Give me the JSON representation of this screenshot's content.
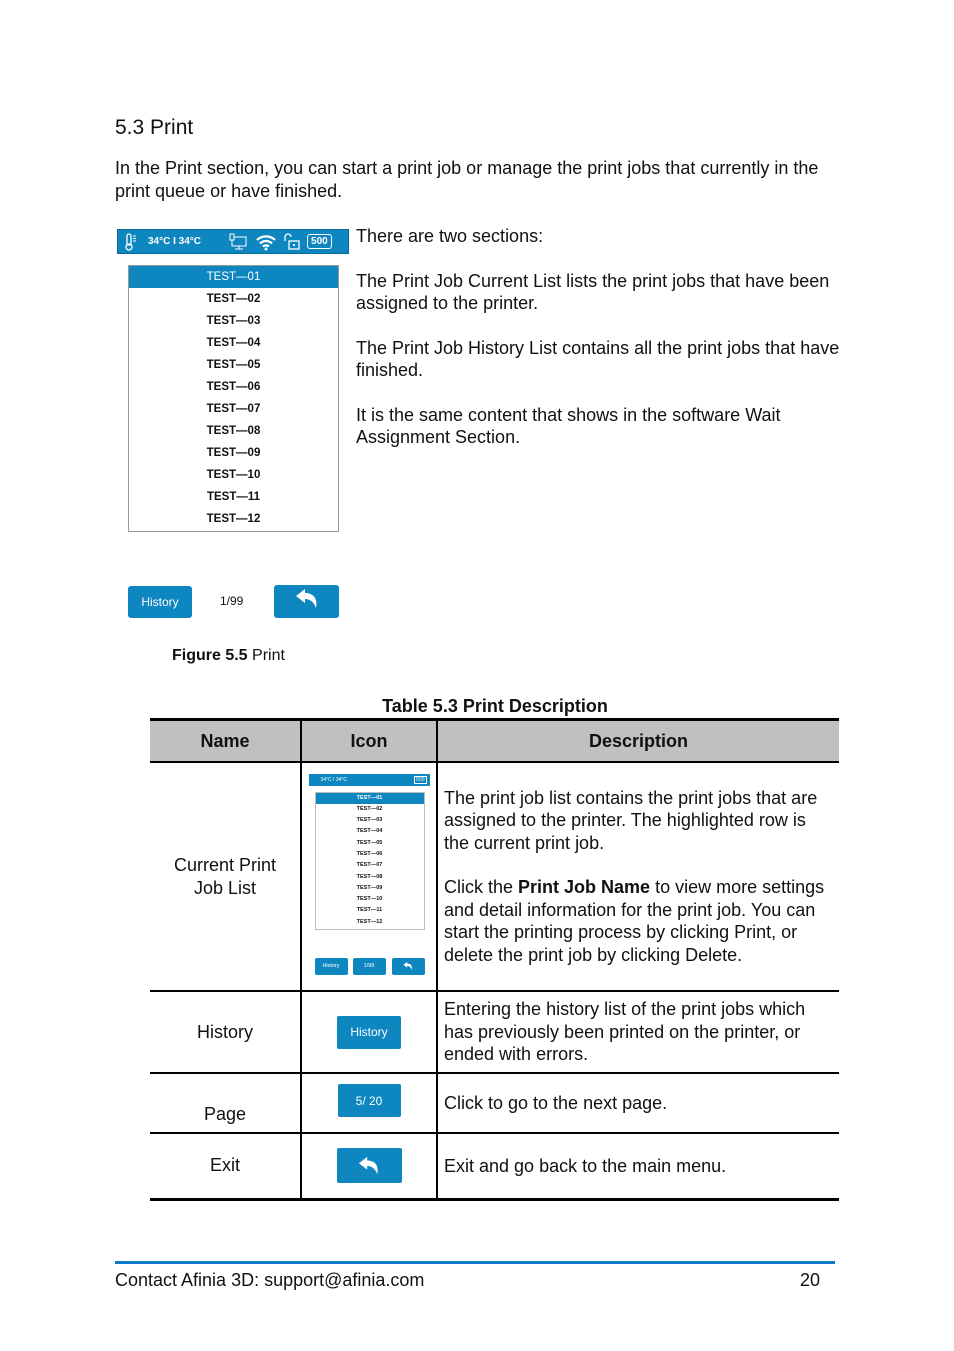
{
  "section": {
    "heading": "5.3 Print",
    "intro": "In the Print section, you can start a print job or manage the print jobs that currently in the print queue or have finished.",
    "side_paragraphs": [
      "There are two sections:",
      "The Print Job Current List lists the print jobs that have been assigned to the printer.",
      "The Print Job History List contains all the print jobs that have finished.",
      "It is the same content that shows in the software Wait Assignment Section."
    ]
  },
  "device_screen": {
    "status_bar": {
      "temperature": "34°C I 34°C",
      "icons": [
        "thermometer-icon",
        "network-icon",
        "wifi-icon",
        "unlock-icon"
      ],
      "badge": "500"
    },
    "jobs": [
      "TEST—01",
      "TEST—02",
      "TEST—03",
      "TEST—04",
      "TEST—05",
      "TEST—06",
      "TEST—07",
      "TEST—08",
      "TEST—09",
      "TEST—10",
      "TEST—11",
      "TEST—12"
    ],
    "selected_index": 0,
    "history_button": "History",
    "page_indicator": "1/99",
    "back_icon": "back-arrow-icon",
    "accent_color": "#0e87c0"
  },
  "figure_caption": {
    "label": "Figure 5.5",
    "text": " Print"
  },
  "table": {
    "caption": "Table 5.3 Print Description",
    "headers": [
      "Name",
      "Icon",
      "Description"
    ],
    "rows": [
      {
        "name": "Current Print Job List",
        "name_line1": "Current Print",
        "name_line2": "Job List",
        "icon": {
          "type": "screen-thumbnail",
          "status": "34°C I 34°C",
          "badge": "500",
          "buttons": [
            "History",
            "1/99"
          ]
        },
        "desc_p1": "The print job list contains the print jobs that are assigned to the printer. The highlighted row is the current print job.",
        "desc_p2_pre": "Click the ",
        "desc_p2_bold": "Print Job Name",
        "desc_p2_post": " to view more settings and detail information for the print job. You can start the printing process by clicking Print, or delete the print job by clicking Delete."
      },
      {
        "name": "History",
        "icon": {
          "type": "button",
          "label": "History"
        },
        "description": "Entering the history list of the print jobs which has previously been printed on the printer, or ended with errors."
      },
      {
        "name": "Page",
        "icon": {
          "type": "button",
          "label": "5/ 20"
        },
        "description": "Click to go to the next page."
      },
      {
        "name": "Exit",
        "icon": {
          "type": "button",
          "label": "back-arrow-icon"
        },
        "description": "Exit and go back to the main menu."
      }
    ]
  },
  "footer": {
    "contact": "Contact Afinia 3D: support@afinia.com",
    "page_number": "20",
    "rule_color": "#0a7bc4"
  }
}
